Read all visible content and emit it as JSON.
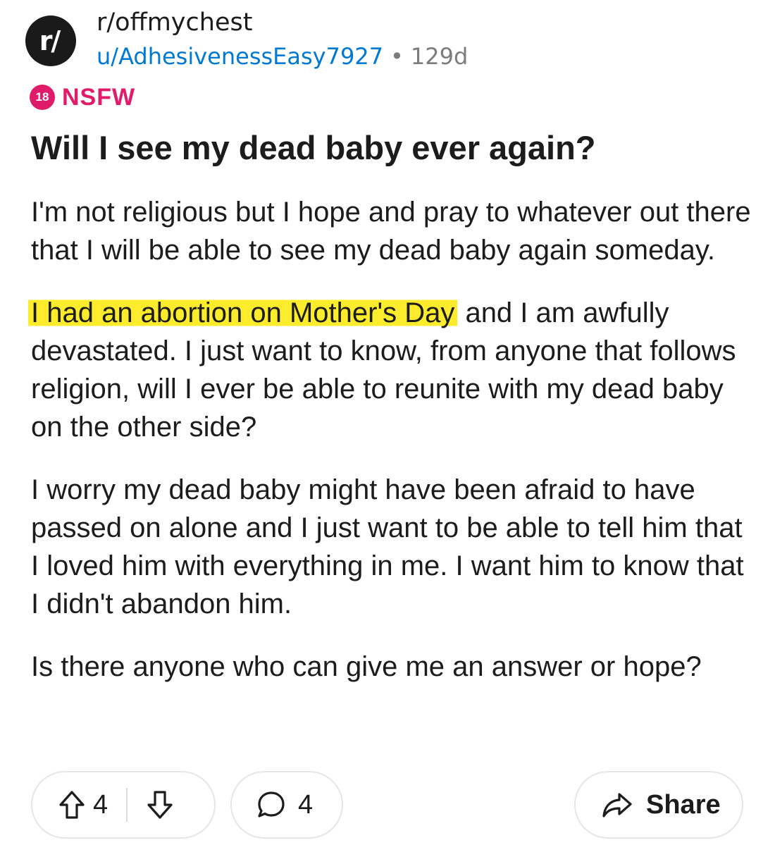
{
  "header": {
    "avatar_text": "r/",
    "subreddit": "r/offmychest",
    "username": "u/AdhesivenessEasy7927",
    "separator": "•",
    "age": "129d"
  },
  "nsfw": {
    "icon_text": "18",
    "label": "NSFW",
    "color": "#e01b6a"
  },
  "post": {
    "title": "Will I see my dead baby ever again?",
    "paragraphs": [
      "I'm not religious but I hope and pray to whatever out there that I will be able to see my dead baby again someday.",
      {
        "highlighted": "I had an abortion on Mother's Day",
        "rest": " and I am awfully devastated. I just want to know, from anyone that follows religion, will I ever be able to reunite with my dead baby on the other side?"
      },
      "I worry my dead baby might have been afraid to have passed on alone and I just want to be able to tell him that I loved him with everything in me. I want him to know that I didn't abandon him.",
      "Is there anyone who can give me an answer or hope?"
    ],
    "highlight_color": "#fdec2c"
  },
  "actions": {
    "upvote_icon": "upvote-arrow-icon",
    "vote_count": "4",
    "downvote_icon": "downvote-arrow-icon",
    "comment_icon": "comment-bubble-icon",
    "comment_count": "4",
    "share_icon": "share-arrow-icon",
    "share_label": "Share"
  },
  "colors": {
    "link_blue": "#0079d3",
    "meta_gray": "#7c7c7c",
    "text": "#1c1c1c"
  }
}
